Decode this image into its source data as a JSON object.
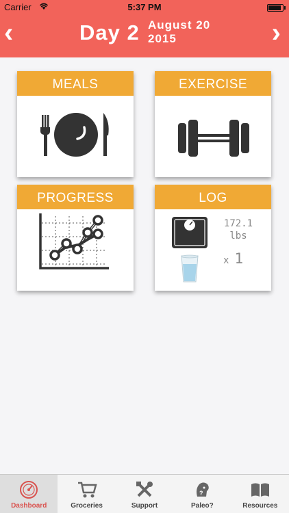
{
  "status": {
    "carrier": "Carrier",
    "time": "5:37 PM",
    "battery_level": 0.95
  },
  "header": {
    "day": "Day 2",
    "date_line1": "August 20",
    "date_line2": "2015",
    "prev_icon": "chevron-left-icon",
    "next_icon": "chevron-right-icon"
  },
  "tiles": {
    "meals": {
      "label": "MEALS",
      "icon": "plate-utensils-icon"
    },
    "exercise": {
      "label": "EXERCISE",
      "icon": "dumbbell-icon"
    },
    "progress": {
      "label": "PROGRESS",
      "icon": "line-chart-icon"
    },
    "log": {
      "label": "LOG",
      "weight_value": "172.1",
      "weight_unit": "lbs",
      "glasses_prefix": "x",
      "glasses_count": "1",
      "scale_icon": "scale-icon",
      "glass_icon": "water-glass-icon"
    }
  },
  "tabs": [
    {
      "label": "Dashboard",
      "icon": "gauge-icon",
      "active": true
    },
    {
      "label": "Groceries",
      "icon": "cart-icon",
      "active": false
    },
    {
      "label": "Support",
      "icon": "tools-icon",
      "active": false
    },
    {
      "label": "Paleo?",
      "icon": "caveman-icon",
      "active": false
    },
    {
      "label": "Resources",
      "icon": "book-icon",
      "active": false
    }
  ],
  "colors": {
    "header": "#f2635a",
    "tile_banner": "#f0a935",
    "icon_dark": "#333333",
    "active_tab_text": "#d9534f"
  }
}
